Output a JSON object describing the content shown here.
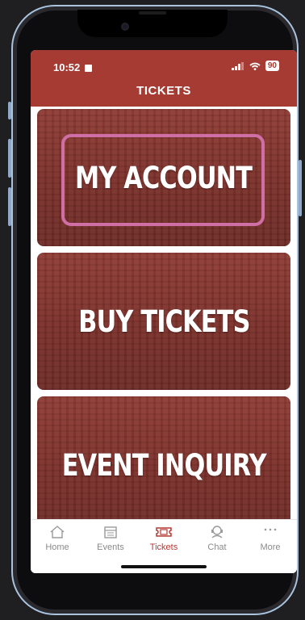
{
  "status_bar": {
    "time": "10:52",
    "battery": "90"
  },
  "header": {
    "title": "TICKETS"
  },
  "tiles": [
    {
      "label": "MY ACCOUNT"
    },
    {
      "label": "BUY TICKETS"
    },
    {
      "label": "EVENT INQUIRY"
    }
  ],
  "tabs": [
    {
      "label": "Home",
      "icon": "home-icon"
    },
    {
      "label": "Events",
      "icon": "calendar-icon"
    },
    {
      "label": "Tickets",
      "icon": "ticket-icon",
      "active": true
    },
    {
      "label": "Chat",
      "icon": "chat-icon"
    },
    {
      "label": "More",
      "icon": "more-icon"
    }
  ],
  "colors": {
    "brand": "#a53b32",
    "tile": "#7f322c",
    "highlight": "#cf6fa6",
    "tab_active": "#b33a34",
    "tab_inactive": "#8a8a8a"
  }
}
